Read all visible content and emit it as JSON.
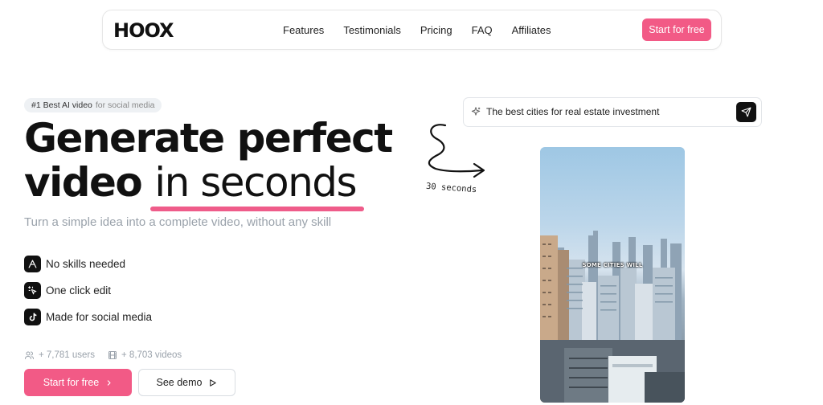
{
  "nav": {
    "logo": "HOOX",
    "links": [
      "Features",
      "Testimonials",
      "Pricing",
      "FAQ",
      "Affiliates"
    ],
    "cta": "Start for free"
  },
  "hero": {
    "badge_strong": "#1 Best AI video",
    "badge_muted": "for social media",
    "title_line1": "Generate perfect",
    "title_line2_bold": "video",
    "title_line2_light": "in seconds",
    "subtitle": "Turn a simple idea into a complete video, without any skill",
    "features": [
      {
        "label": "No skills needed",
        "icon": "pen-nib-icon"
      },
      {
        "label": "One click edit",
        "icon": "magic-cursor-icon"
      },
      {
        "label": "Made for social media",
        "icon": "tiktok-icon"
      }
    ],
    "stats": {
      "users": "+ 7,781 users",
      "videos": "+ 8,703 videos"
    },
    "primary_cta": "Start for free",
    "secondary_cta": "See demo"
  },
  "demo": {
    "prompt_text": "The best cities for real estate investment",
    "annotation": "30 seconds",
    "video_caption": "SOME CITIES WILL"
  },
  "colors": {
    "accent": "#f25a86",
    "underline": "#ef5c8a",
    "dark": "#111111",
    "muted": "#9aa2ab"
  }
}
